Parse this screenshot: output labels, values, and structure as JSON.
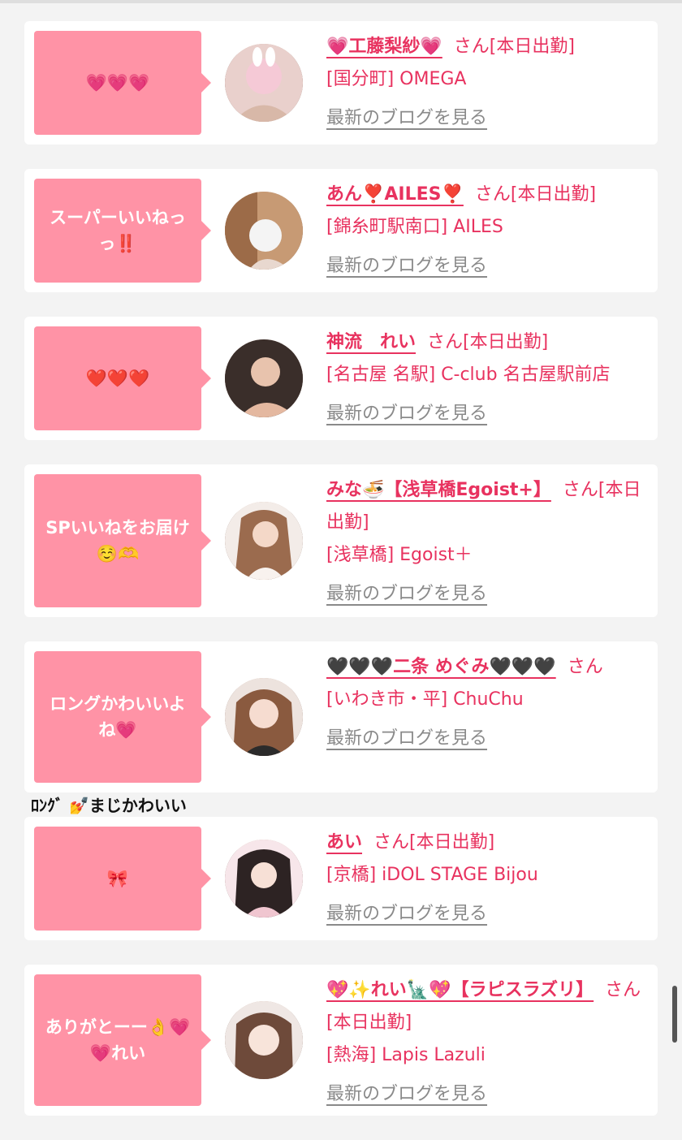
{
  "cards": [
    {
      "bubble": "💗💗💗",
      "name": "💗工藤梨紗💗",
      "san": "さん[本日出勤]",
      "shop": "[国分町] OMEGA",
      "blog": "最新のブログを見る"
    },
    {
      "bubble": "スーパーいいねっっ‼️",
      "name": "あん❣️AILES❣️",
      "san": "さん[本日出勤]",
      "shop": "[錦糸町駅南口] AILES",
      "blog": "最新のブログを見る"
    },
    {
      "bubble": "❤️❤️❤️",
      "name": "神流　れい",
      "san": "さん[本日出勤]",
      "shop": "[名古屋 名駅] C-club 名古屋駅前店",
      "blog": "最新のブログを見る"
    },
    {
      "bubble": "SPいいねをお届け☺️🫶",
      "name": "みな🍜【浅草橋Egoist+】",
      "san": "さん[本日出勤]",
      "shop": "[浅草橋] Egoist＋",
      "blog": "最新のブログを見る"
    },
    {
      "bubble": "ロングかわいいよね💗",
      "name": "🖤🖤🖤二条 めぐみ🖤🖤🖤",
      "san": "さん",
      "shop": "[いわき市・平] ChuChu",
      "blog": "最新のブログを見る"
    },
    {
      "bubble": "🎀",
      "name": "あい",
      "san": "さん[本日出勤]",
      "shop": "[京橋] iDOL STAGE Bijou",
      "blog": "最新のブログを見る"
    },
    {
      "bubble": "ありがとーー👌💗💗れい",
      "name": "💖✨れい🗽💖【ラピスラズリ】",
      "san": "さん[本日出勤]",
      "shop": "[熱海] Lapis Lazuli",
      "blog": "最新のブログを見る"
    }
  ],
  "overlay_caption": "ﾛﾝｸﾞ 💅まじかわいい",
  "colors": {
    "bubble": "#ff93a6",
    "accent": "#e8325f",
    "link_gray": "#8a8a8a",
    "bg": "#f3f3f3"
  }
}
